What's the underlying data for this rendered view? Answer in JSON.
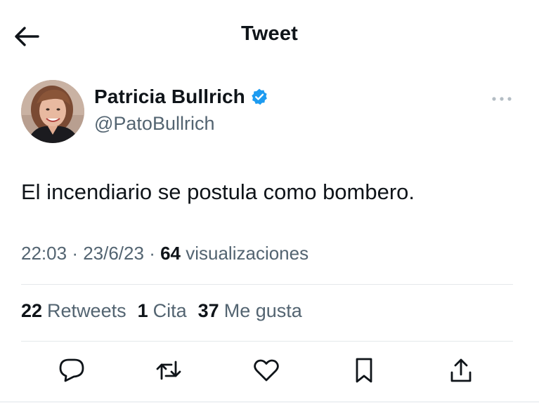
{
  "header": {
    "title": "Tweet",
    "back_icon": "arrow-left-icon"
  },
  "author": {
    "display_name": "Patricia Bullrich",
    "handle": "@PatoBullrich",
    "verified": true,
    "verified_color": "#1d9bf0"
  },
  "tweet": {
    "text": "El incendiario se postula como bombero.",
    "time": "22:03",
    "separator": "·",
    "date": "23/6/23",
    "views_count": "64",
    "views_label": "visualizaciones"
  },
  "stats": [
    {
      "count": "22",
      "label": "Retweets"
    },
    {
      "count": "1",
      "label": "Cita"
    },
    {
      "count": "37",
      "label": "Me gusta"
    }
  ],
  "actions": [
    {
      "name": "reply",
      "icon": "comment-icon"
    },
    {
      "name": "retweet",
      "icon": "retweet-icon"
    },
    {
      "name": "like",
      "icon": "heart-icon"
    },
    {
      "name": "bookmark",
      "icon": "bookmark-icon"
    },
    {
      "name": "share",
      "icon": "share-icon"
    }
  ],
  "colors": {
    "text_primary": "#0f1419",
    "text_secondary": "#536471",
    "divider": "#e4e8eb"
  }
}
